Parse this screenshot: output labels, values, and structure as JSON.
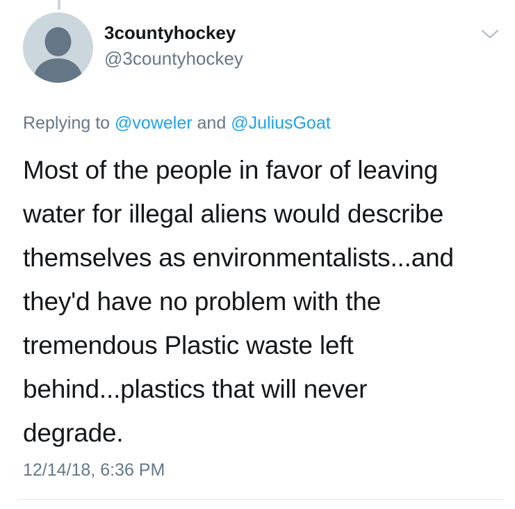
{
  "tweet": {
    "display_name": "3countyhockey",
    "handle": "@3countyhockey",
    "replying_prefix": "Replying to",
    "mention_1": "@voweler",
    "replying_and": "and",
    "mention_2": "@JuliusGoat",
    "text_lines": [
      "Most of the people in favor of leaving",
      "water for illegal aliens would describe",
      "themselves as environmentalists...and",
      "they'd have no problem with the",
      "tremendous Plastic waste left",
      "behind...plastics that will never",
      "degrade."
    ],
    "timestamp": "12/14/18, 6:36 PM"
  },
  "icons": {
    "avatar": "default-avatar-icon",
    "menu": "chevron-down-icon"
  },
  "colors": {
    "primary_text": "#14171a",
    "secondary_text": "#657786",
    "link": "#1da1f2",
    "avatar_bg": "#ccd6dd",
    "avatar_fg": "#657786",
    "divider": "#e1e8ed"
  }
}
